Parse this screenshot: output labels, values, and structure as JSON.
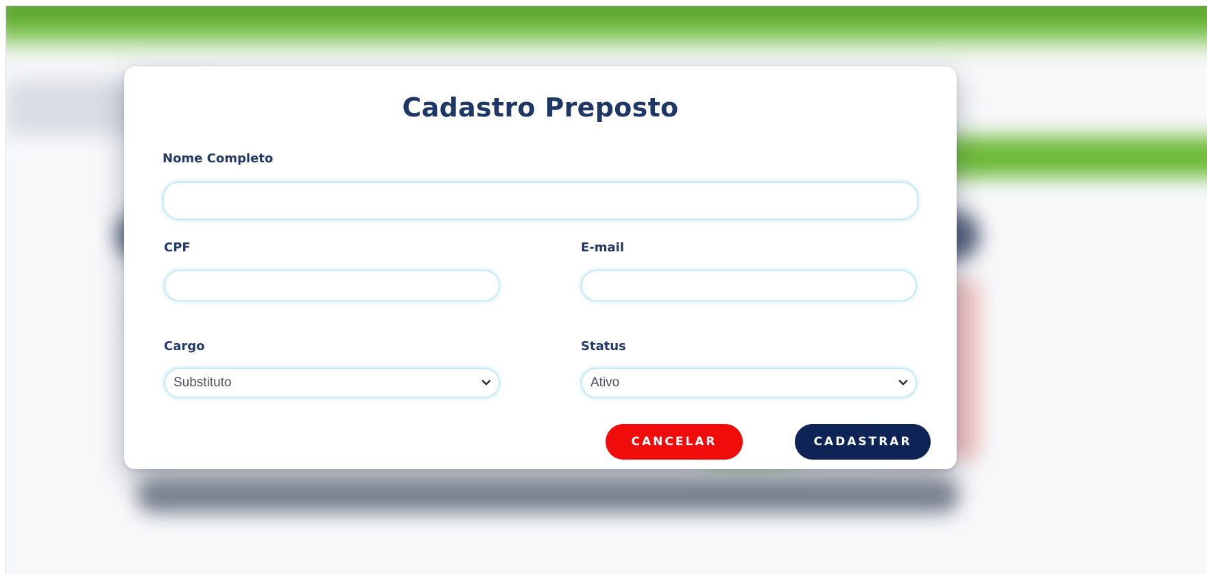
{
  "modal": {
    "title": "Cadastro Preposto"
  },
  "form": {
    "nome": {
      "label": "Nome Completo",
      "value": "",
      "placeholder": ""
    },
    "cpf": {
      "label": "CPF",
      "value": "",
      "placeholder": ""
    },
    "email": {
      "label": "E-mail",
      "value": "",
      "placeholder": ""
    },
    "cargo": {
      "label": "Cargo",
      "selected": "Substituto"
    },
    "status": {
      "label": "Status",
      "selected": "Ativo"
    }
  },
  "actions": {
    "cancel_label": "CANCELAR",
    "submit_label": "CADASTRAR"
  },
  "colors": {
    "title": "#1f3766",
    "label": "#233a68",
    "cancel": "#f10c0c",
    "submit": "#0e2457",
    "input_border": "#c8ecf5",
    "topbar_green": "#5aa82a"
  },
  "icons": {
    "select_arrow": "chevron-down-icon"
  }
}
